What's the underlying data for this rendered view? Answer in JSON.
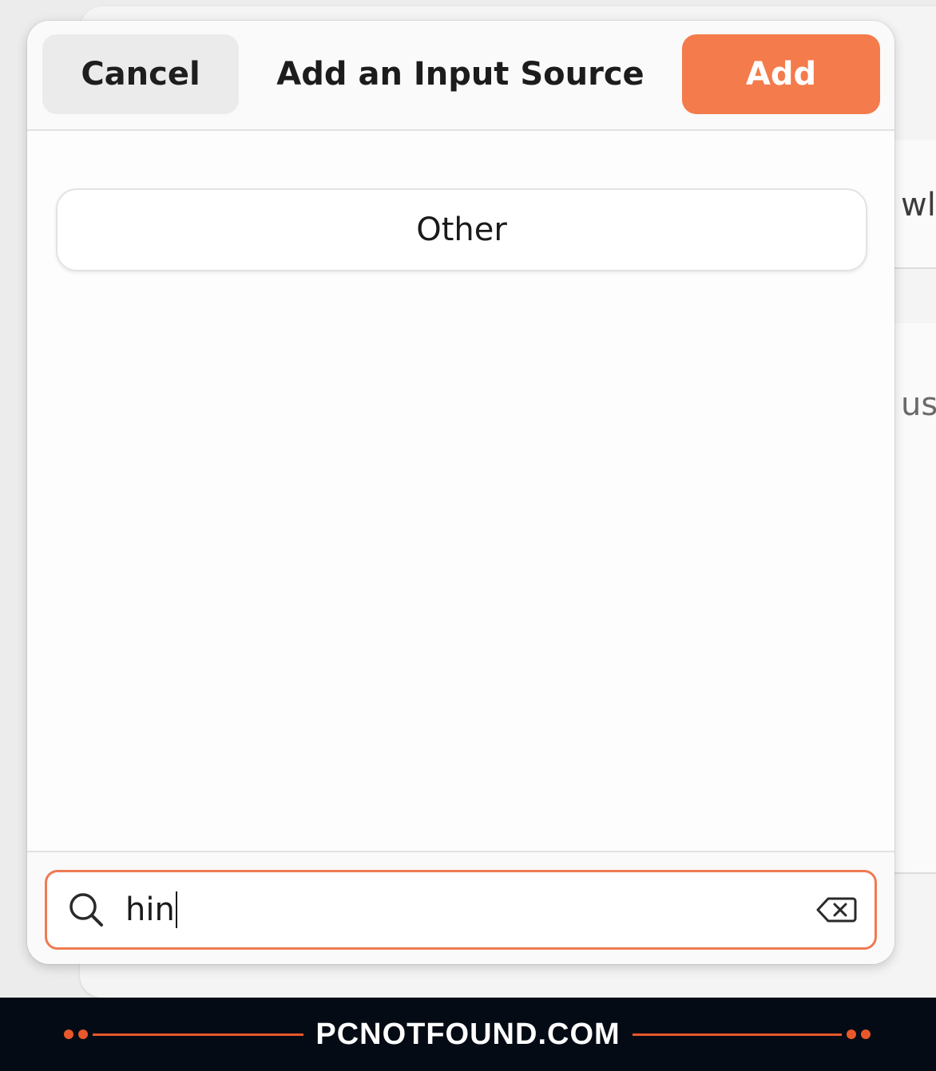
{
  "background": {
    "row_text_1": "wl",
    "row_text_2": "us"
  },
  "dialog": {
    "title": "Add an Input Source",
    "cancel_label": "Cancel",
    "add_label": "Add",
    "list_items": [
      {
        "label": "Other"
      }
    ],
    "search": {
      "value": "hin",
      "icon": "search-icon",
      "clear_icon": "backspace-clear-icon"
    }
  },
  "colors": {
    "accent": "#f47b4c",
    "focus_border": "#ef7a52",
    "banner_bg": "#050b14",
    "banner_accent": "#e8582a"
  },
  "watermark": {
    "text": "PCNOTFOUND.COM"
  }
}
